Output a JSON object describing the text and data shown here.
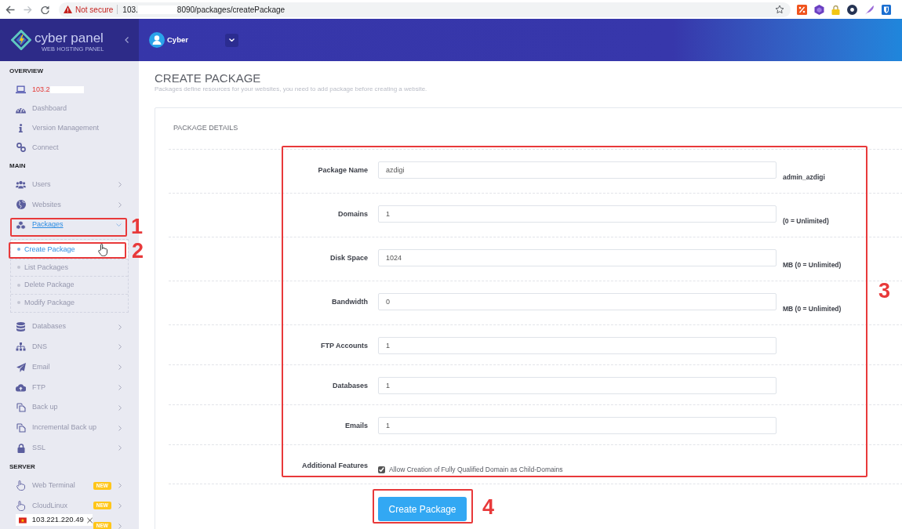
{
  "browser": {
    "security": "Not secure",
    "url_start": "103.",
    "url_redacted": true,
    "url_end": "8090/packages/createPackage"
  },
  "header": {
    "logo_text": "cyber panel",
    "logo_tagline": "WEB HOSTING PANEL",
    "user": "Cyber"
  },
  "sidebar": {
    "sections": [
      {
        "heading": "OVERVIEW",
        "items": [
          {
            "kind": "server",
            "label": "103.2",
            "redacted": true
          },
          {
            "kind": "link",
            "label": "Dashboard"
          },
          {
            "kind": "link",
            "label": "Version Management"
          },
          {
            "kind": "link",
            "label": "Connect"
          }
        ]
      },
      {
        "heading": "MAIN",
        "items": [
          {
            "kind": "menu",
            "label": "Users",
            "expanded": false
          },
          {
            "kind": "menu",
            "label": "Websites",
            "expanded": false
          },
          {
            "kind": "menu",
            "label": "Packages",
            "expanded": true,
            "children": [
              {
                "label": "Create Package",
                "selected": true
              },
              {
                "label": "List Packages",
                "selected": false
              },
              {
                "label": "Delete Package",
                "selected": false
              },
              {
                "label": "Modify Package",
                "selected": false
              }
            ]
          },
          {
            "kind": "menu",
            "label": "Databases",
            "expanded": false
          },
          {
            "kind": "menu",
            "label": "DNS",
            "expanded": false
          },
          {
            "kind": "menu",
            "label": "Email",
            "expanded": false
          },
          {
            "kind": "menu",
            "label": "FTP",
            "expanded": false
          },
          {
            "kind": "menu",
            "label": "Back up",
            "expanded": false
          },
          {
            "kind": "menu",
            "label": "Incremental Back up",
            "expanded": false
          },
          {
            "kind": "menu",
            "label": "SSL",
            "expanded": false
          }
        ]
      },
      {
        "heading": "SERVER",
        "items": [
          {
            "kind": "menu",
            "label": "Web Terminal",
            "badge": "NEW",
            "expanded": false
          },
          {
            "kind": "menu",
            "label": "CloudLinux",
            "badge": "NEW",
            "expanded": false
          },
          {
            "kind": "menu",
            "badge": "NEW",
            "expanded": false
          }
        ]
      }
    ]
  },
  "page": {
    "title": "CREATE PACKAGE",
    "subtitle": "Packages define resources for your websites, you need to add package before creating a website.",
    "card": {
      "heading": "PACKAGE DETAILS",
      "fields": [
        {
          "label": "Package Name",
          "value": "azdigi",
          "hint": "admin_azdigi"
        },
        {
          "label": "Domains",
          "value": "1",
          "hint": "(0 = Unlimited)"
        },
        {
          "label": "Disk Space",
          "value": "1024",
          "hint": "MB (0 = Unlimited)"
        },
        {
          "label": "Bandwidth",
          "value": "0",
          "hint": "MB (0 = Unlimited)"
        },
        {
          "label": "FTP Accounts",
          "value": "1"
        },
        {
          "label": "Databases",
          "value": "1"
        },
        {
          "label": "Emails",
          "value": "1"
        }
      ],
      "features": {
        "label": "Additional Features",
        "options": [
          {
            "label": "Allow Creation of Fully Qualified Domain as Child-Domains",
            "checked": true
          }
        ]
      },
      "submit": "Create Package"
    }
  },
  "annotations": [
    {
      "number": "1"
    },
    {
      "number": "2"
    },
    {
      "number": "3"
    },
    {
      "number": "4"
    }
  ],
  "ip_popup": {
    "text": "103.221.220.49"
  }
}
